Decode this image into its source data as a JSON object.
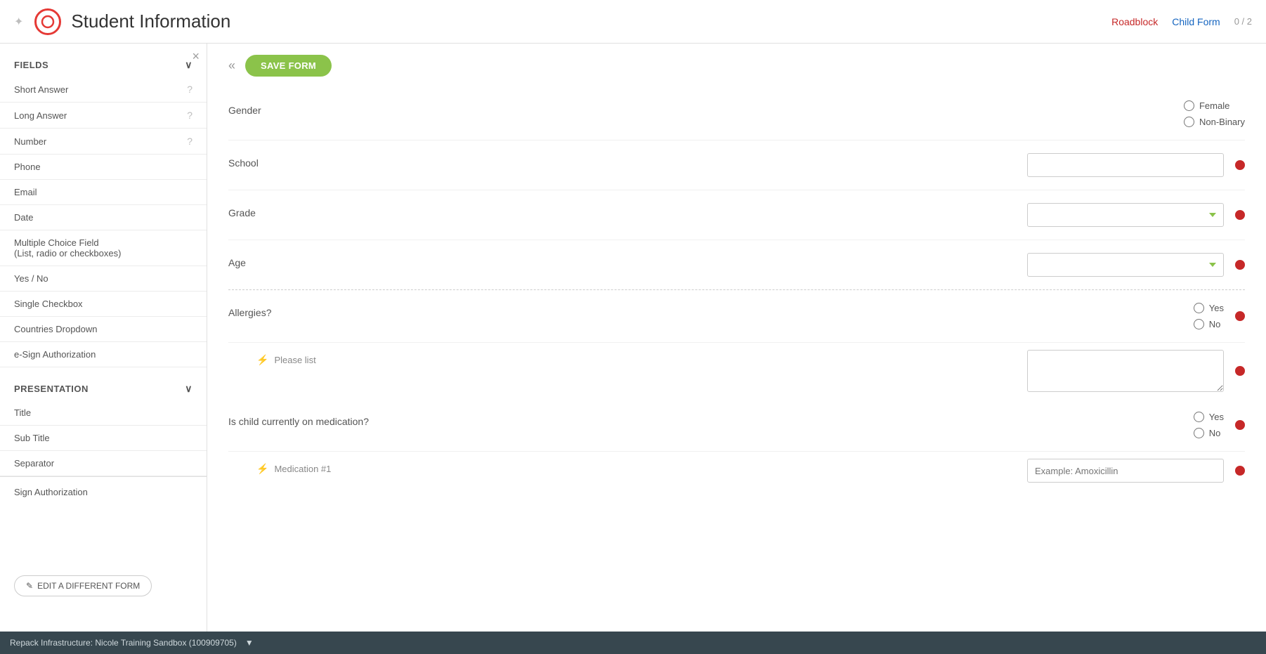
{
  "header": {
    "title": "Student Information",
    "logo_alt": "logo",
    "roadblock_label": "Roadblock",
    "childform_label": "Child Form",
    "counter": "0 / 2"
  },
  "sidebar": {
    "close_icon": "×",
    "fields_label": "FIELDS",
    "fields_chevron": "∨",
    "items": [
      {
        "label": "Short Answer",
        "has_help": true
      },
      {
        "label": "Long Answer",
        "has_help": true
      },
      {
        "label": "Number",
        "has_help": true
      },
      {
        "label": "Phone",
        "has_help": false
      },
      {
        "label": "Email",
        "has_help": false
      },
      {
        "label": "Date",
        "has_help": false
      },
      {
        "label": "Multiple Choice Field\n(List, radio or checkboxes)",
        "has_help": false
      },
      {
        "label": "Yes / No",
        "has_help": false
      },
      {
        "label": "Single Checkbox",
        "has_help": false
      },
      {
        "label": "Countries Dropdown",
        "has_help": false
      },
      {
        "label": "e-Sign Authorization",
        "has_help": false
      }
    ],
    "presentation_label": "PRESENTATION",
    "presentation_chevron": "∨",
    "presentation_items": [
      {
        "label": "Title"
      },
      {
        "label": "Sub Title"
      },
      {
        "label": "Separator"
      }
    ],
    "edit_form_btn": "✎ EDIT A DIFFERENT FORM",
    "sign_auth_label": "Sign Authorization"
  },
  "toolbar": {
    "collapse_icon": "«",
    "save_form_label": "SAVE FORM"
  },
  "form": {
    "gender_label": "Gender",
    "gender_options": [
      "Female",
      "Non-Binary"
    ],
    "school_label": "School",
    "grade_label": "Grade",
    "age_label": "Age",
    "allergies_label": "Allergies?",
    "allergies_options": [
      "Yes",
      "No"
    ],
    "please_list_label": "Please list",
    "medication_label": "Is child currently on medication?",
    "medication_options": [
      "Yes",
      "No"
    ],
    "medication1_label": "Medication #1",
    "medication1_placeholder": "Example: Amoxicillin"
  },
  "bottom_bar": {
    "text": "Repack Infrastructure: Nicole Training Sandbox (100909705)",
    "chevron": "▼"
  }
}
